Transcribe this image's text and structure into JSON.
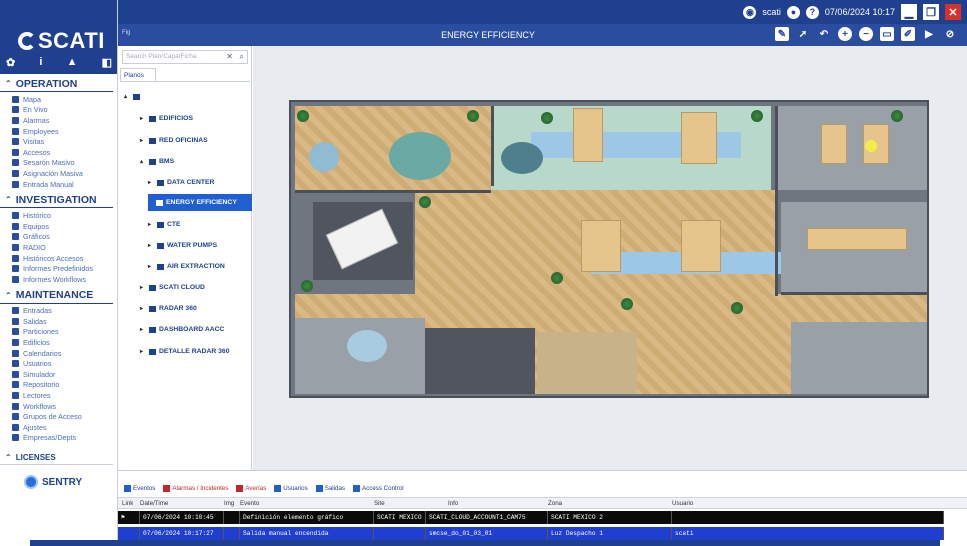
{
  "topbar": {
    "user": "scati",
    "datetime": "07/06/2024 10:17",
    "minimize": "▁",
    "restore": "❐",
    "close": "✕"
  },
  "brand": {
    "name": "SCATI"
  },
  "sidebar": {
    "operation": {
      "title": "OPERATION",
      "items": [
        {
          "label": "Mapa"
        },
        {
          "label": "En Vivo"
        },
        {
          "label": "Alarmas"
        },
        {
          "label": "Employees"
        },
        {
          "label": "Visitas"
        },
        {
          "label": "Accesos"
        },
        {
          "label": "Sesarón Masivo"
        },
        {
          "label": "Asignación Masiva"
        },
        {
          "label": "Entrada Manual"
        }
      ]
    },
    "investigation": {
      "title": "INVESTIGATION",
      "items": [
        {
          "label": "Histórico"
        },
        {
          "label": "Equipos"
        },
        {
          "label": "Gráficos"
        },
        {
          "label": "RADIO"
        },
        {
          "label": "Históricos Accesos"
        },
        {
          "label": "Informes Predefinidos"
        },
        {
          "label": "Informes Workflows"
        }
      ]
    },
    "maintenance": {
      "title": "MAINTENANCE",
      "items": [
        {
          "label": "Entradas"
        },
        {
          "label": "Salidas"
        },
        {
          "label": "Particiones"
        },
        {
          "label": "Edificios"
        },
        {
          "label": "Calendarios"
        },
        {
          "label": "Usuarios"
        },
        {
          "label": "Simulador"
        },
        {
          "label": "Repositorio"
        },
        {
          "label": "Lectores"
        },
        {
          "label": "Workflows"
        },
        {
          "label": "Grupos de Acceso"
        },
        {
          "label": "Ajustes"
        },
        {
          "label": "Empresas/Depts"
        }
      ]
    },
    "licenses": {
      "title": "LICENSES",
      "product": "SENTRY"
    }
  },
  "titlebar": {
    "title": "ENERGY EFFICIENCY",
    "tab_marker": "Flg"
  },
  "tree": {
    "search_placeholder": "Search Plan/Capa/Ficha",
    "tab": "Planos",
    "nodes": [
      {
        "label": "EDIFICIOS"
      },
      {
        "label": "RED OFICINAS"
      },
      {
        "label": "BMS"
      },
      {
        "label": "DATA CENTER"
      },
      {
        "label": "ENERGY EFFICIENCY"
      },
      {
        "label": "CTE"
      },
      {
        "label": "WATER PUMPS"
      },
      {
        "label": "AIR EXTRACTION"
      },
      {
        "label": "SCATI CLOUD"
      },
      {
        "label": "RADAR 360"
      },
      {
        "label": "DASHBOARD AACC"
      },
      {
        "label": "DETALLE RADAR 360"
      }
    ]
  },
  "events": {
    "tabs": [
      "Eventos",
      "Alarmas / Incidentes",
      "Averías",
      "Usuarios",
      "Salidas",
      "Access Control"
    ],
    "columns": [
      "Link",
      "Date/Time",
      "Img",
      "Evento",
      "Site",
      "Info",
      "Zona",
      "Usuario"
    ],
    "rows": [
      {
        "date": "07/06/2024 10:10:45",
        "evento": "Definición elemento gráfico",
        "site": "SCATI MEXICO",
        "info": "SCATI_CLOUD_ACCOUNT1_CAM75",
        "zona": "SCATI MEXICO 2",
        "usuario": ""
      },
      {
        "date": "07/06/2024 10:17:27",
        "evento": "Salida manual encendida",
        "site": "",
        "info": "smcse_do_01_03_01",
        "zona": "Luz Despacho 1",
        "usuario": "scati"
      }
    ]
  }
}
